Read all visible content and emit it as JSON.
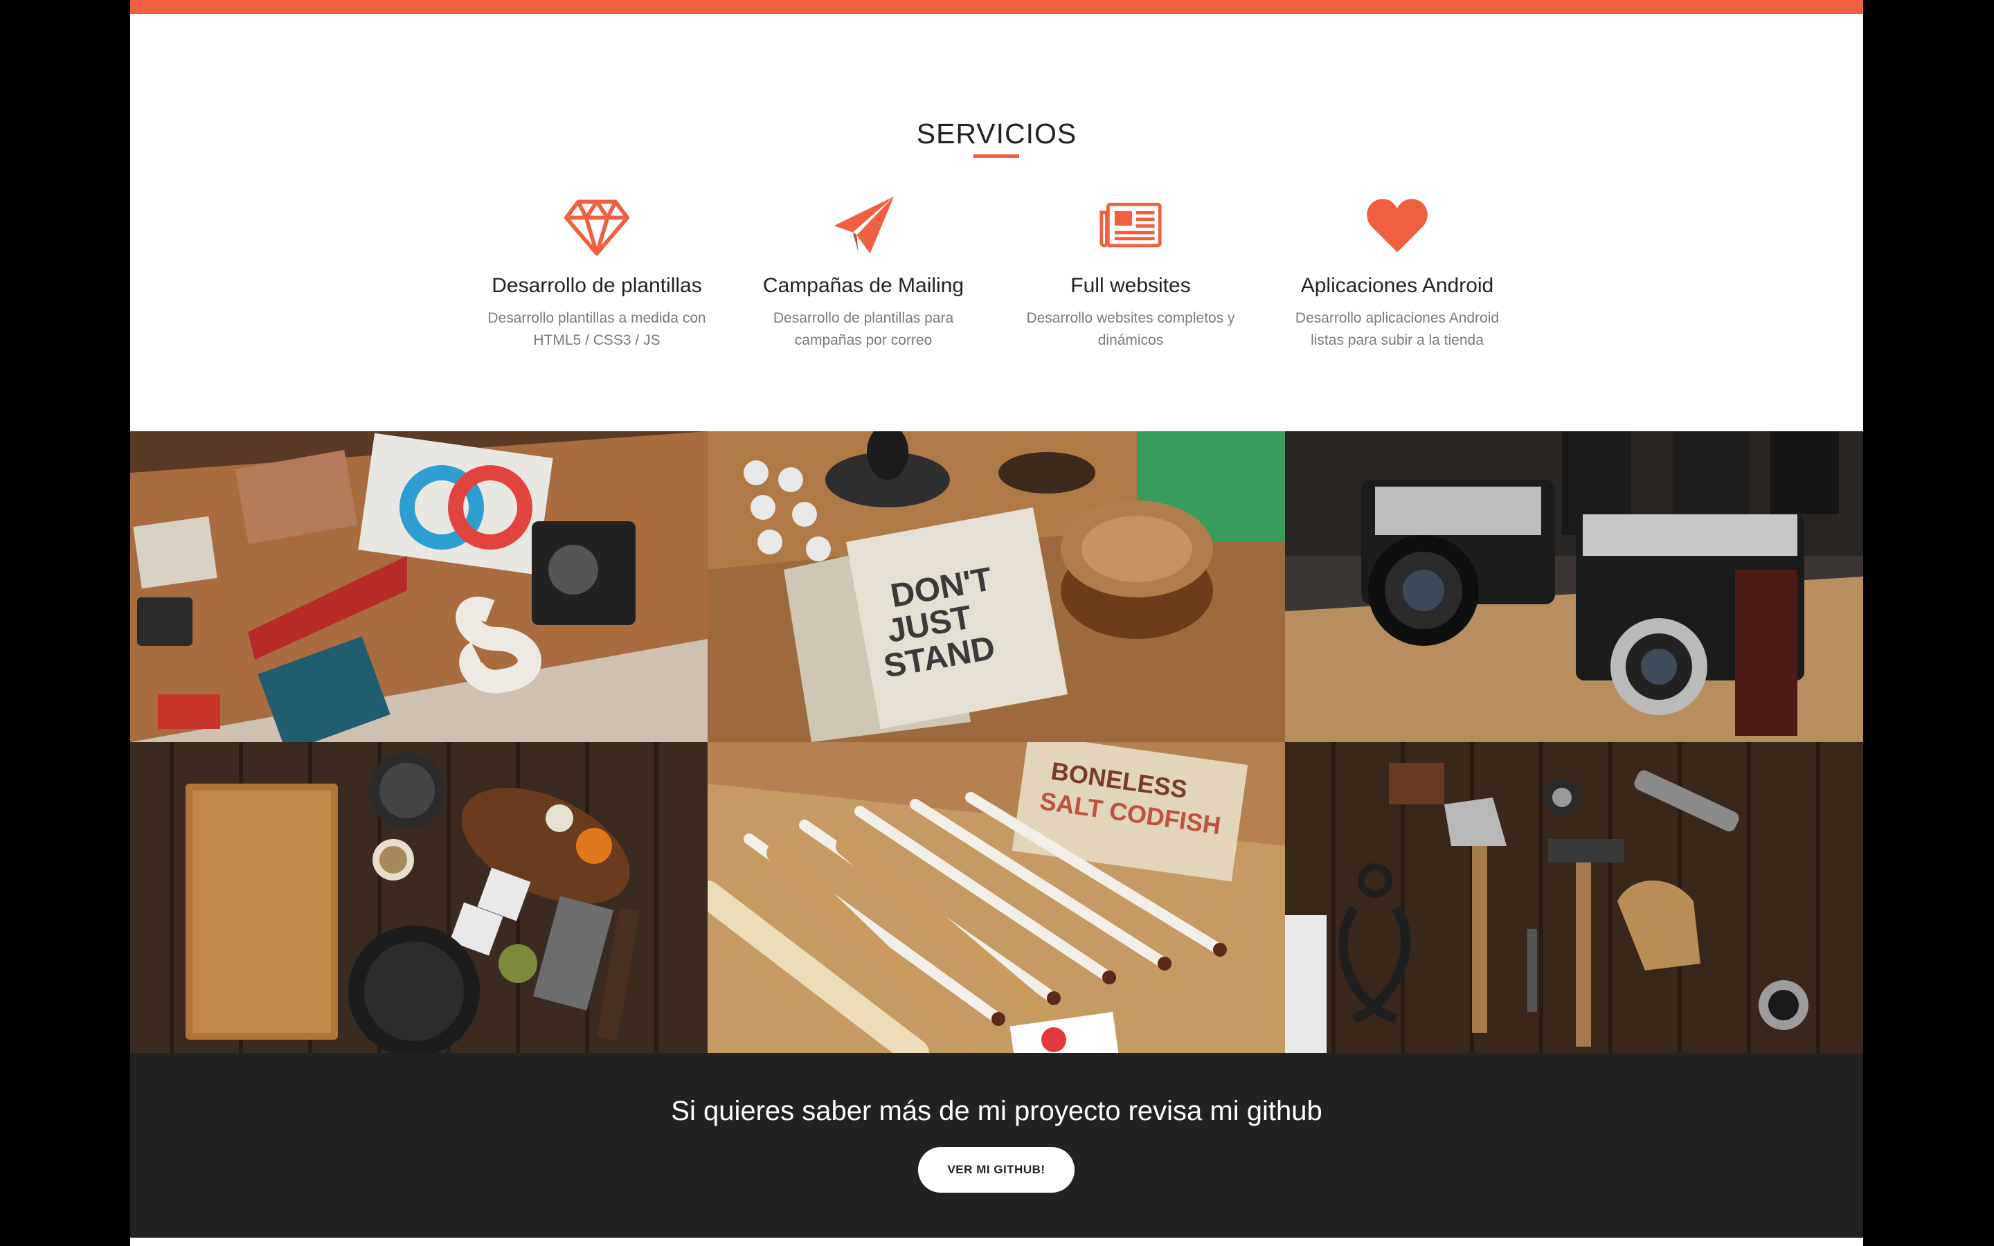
{
  "colors": {
    "accent": "#f05f40",
    "dark": "#222222",
    "muted": "#7a7a7a",
    "outer_background": "#000000"
  },
  "services": {
    "title": "SERVICIOS",
    "items": [
      {
        "icon": "diamond-icon",
        "name": "Desarrollo de plantillas",
        "description": "Desarrollo plantillas a medida con HTML5 / CSS3 / JS"
      },
      {
        "icon": "paper-plane-icon",
        "name": "Campañas de Mailing",
        "description": "Desarrollo de plantillas para campañas por correo"
      },
      {
        "icon": "newspaper-icon",
        "name": "Full websites",
        "description": "Desarrollo websites completos y dinámicos"
      },
      {
        "icon": "heart-icon",
        "name": "Aplicaciones Android",
        "description": "Desarrollo aplicaciones Android listas para subir a la tienda"
      }
    ]
  },
  "gallery": {
    "items": [
      {
        "name": "portfolio-image-flatlay-design"
      },
      {
        "name": "portfolio-image-notebooks"
      },
      {
        "name": "portfolio-image-cameras"
      },
      {
        "name": "portfolio-image-kitchen"
      },
      {
        "name": "portfolio-image-pencils"
      },
      {
        "name": "portfolio-image-tools"
      }
    ]
  },
  "cta": {
    "text": "Si quieres saber más de mi proyecto revisa mi github",
    "button_label": "VER MI GITHUB!"
  }
}
